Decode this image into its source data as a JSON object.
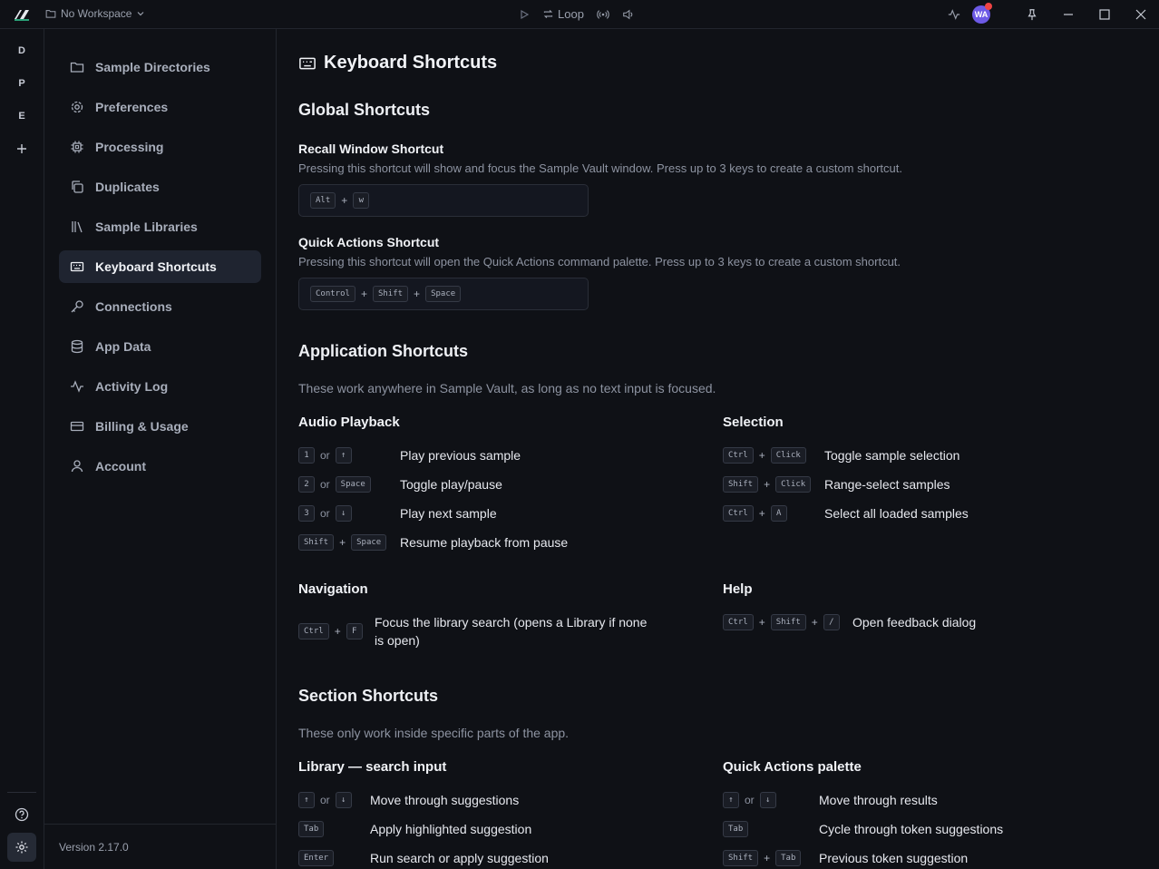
{
  "titlebar": {
    "workspace": "No Workspace",
    "loop_label": "Loop",
    "avatar_initials": "WA"
  },
  "rail": {
    "items": [
      "D",
      "P",
      "E"
    ]
  },
  "sidebar": {
    "items": [
      {
        "label": "Sample Directories",
        "icon": "folder-icon"
      },
      {
        "label": "Preferences",
        "icon": "gear-icon"
      },
      {
        "label": "Processing",
        "icon": "chip-icon"
      },
      {
        "label": "Duplicates",
        "icon": "duplicate-icon"
      },
      {
        "label": "Sample Libraries",
        "icon": "library-icon"
      },
      {
        "label": "Keyboard Shortcuts",
        "icon": "keyboard-icon"
      },
      {
        "label": "Connections",
        "icon": "key-icon"
      },
      {
        "label": "App Data",
        "icon": "database-icon"
      },
      {
        "label": "Activity Log",
        "icon": "activity-icon"
      },
      {
        "label": "Billing & Usage",
        "icon": "card-icon"
      },
      {
        "label": "Account",
        "icon": "user-icon"
      }
    ],
    "version": "Version 2.17.0"
  },
  "main": {
    "title": "Keyboard Shortcuts",
    "global": {
      "heading": "Global Shortcuts",
      "recall": {
        "title": "Recall Window Shortcut",
        "desc": "Pressing this shortcut will show and focus the Sample Vault window. Press up to 3 keys to create a custom shortcut.",
        "k1": "Alt",
        "k2": "w"
      },
      "quick": {
        "title": "Quick Actions Shortcut",
        "desc": "Pressing this shortcut will open the Quick Actions command palette. Press up to 3 keys to create a custom shortcut.",
        "k1": "Control",
        "k2": "Shift",
        "k3": "Space"
      }
    },
    "app": {
      "heading": "Application Shortcuts",
      "desc": "These work anywhere in Sample Vault, as long as no text input is focused.",
      "audio": {
        "heading": "Audio Playback",
        "r1": {
          "k1": "1",
          "or": "or",
          "k2": "↑",
          "label": "Play previous sample"
        },
        "r2": {
          "k1": "2",
          "or": "or",
          "k2": "Space",
          "label": "Toggle play/pause"
        },
        "r3": {
          "k1": "3",
          "or": "or",
          "k2": "↓",
          "label": "Play next sample"
        },
        "r4": {
          "k1": "Shift",
          "plus": "+",
          "k2": "Space",
          "label": "Resume playback from pause"
        }
      },
      "selection": {
        "heading": "Selection",
        "r1": {
          "k1": "Ctrl",
          "plus": "+",
          "k2": "Click",
          "label": "Toggle sample selection"
        },
        "r2": {
          "k1": "Shift",
          "plus": "+",
          "k2": "Click",
          "label": "Range-select samples"
        },
        "r3": {
          "k1": "Ctrl",
          "plus": "+",
          "k2": "A",
          "label": "Select all loaded samples"
        }
      },
      "navigation": {
        "heading": "Navigation",
        "r1": {
          "k1": "Ctrl",
          "plus": "+",
          "k2": "F",
          "label_l1": "Focus the library search (opens a Library if none",
          "label_l2": "is open)"
        }
      },
      "help": {
        "heading": "Help",
        "r1": {
          "k1": "Ctrl",
          "plus1": "+",
          "k2": "Shift",
          "plus2": "+",
          "k3": "/",
          "label": "Open feedback dialog"
        }
      }
    },
    "section": {
      "heading": "Section Shortcuts",
      "desc": "These only work inside specific parts of the app.",
      "library": {
        "heading": "Library — search input",
        "r1": {
          "k1": "↑",
          "or": "or",
          "k2": "↓",
          "label": "Move through suggestions"
        },
        "r2": {
          "k1": "Tab",
          "label": "Apply highlighted suggestion"
        },
        "r3": {
          "k1": "Enter",
          "label": "Run search or apply suggestion"
        }
      },
      "palette": {
        "heading": "Quick Actions palette",
        "r1": {
          "k1": "↑",
          "or": "or",
          "k2": "↓",
          "label": "Move through results"
        },
        "r2": {
          "k1": "Tab",
          "label": "Cycle through token suggestions"
        },
        "r3": {
          "k1": "Shift",
          "plus": "+",
          "k2": "Tab",
          "label": "Previous token suggestion"
        }
      }
    }
  }
}
